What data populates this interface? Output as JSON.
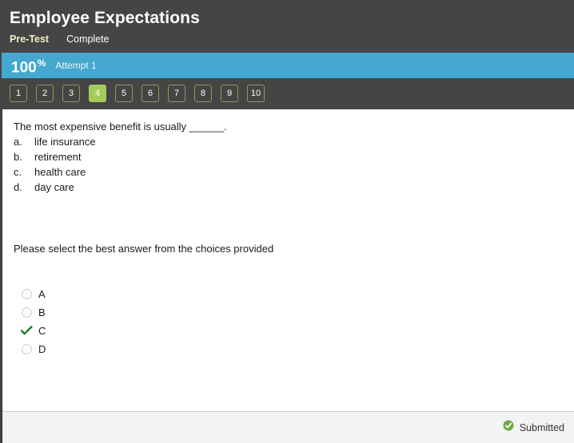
{
  "header": {
    "title": "Employee Expectations",
    "kind": "Pre-Test",
    "status": "Complete"
  },
  "score": {
    "value": "100",
    "percent_symbol": "%",
    "attempt": "Attempt 1",
    "bar_color": "#45a8cf"
  },
  "nav": {
    "buttons": [
      {
        "label": "1",
        "active": false
      },
      {
        "label": "2",
        "active": false
      },
      {
        "label": "3",
        "active": false
      },
      {
        "label": "4",
        "active": true
      },
      {
        "label": "5",
        "active": false
      },
      {
        "label": "6",
        "active": false
      },
      {
        "label": "7",
        "active": false
      },
      {
        "label": "8",
        "active": false
      },
      {
        "label": "9",
        "active": false
      },
      {
        "label": "10",
        "active": false
      }
    ],
    "active_color": "#a5cc5a",
    "border_color": "#8d9a5e"
  },
  "question": {
    "stem": "The most expensive benefit is usually ______.",
    "choices": [
      {
        "letter": "a.",
        "text": "life insurance"
      },
      {
        "letter": "b.",
        "text": "retirement"
      },
      {
        "letter": "c.",
        "text": "health care"
      },
      {
        "letter": "d.",
        "text": "day care"
      }
    ],
    "instruction": "Please select the best answer from the choices provided"
  },
  "answers": {
    "options": [
      {
        "label": "A",
        "selected": false
      },
      {
        "label": "B",
        "selected": false
      },
      {
        "label": "C",
        "selected": true
      },
      {
        "label": "D",
        "selected": false
      }
    ],
    "check_color": "#237a23"
  },
  "footer": {
    "submitted_label": "Submitted",
    "submitted_icon_color": "#6aa844"
  }
}
